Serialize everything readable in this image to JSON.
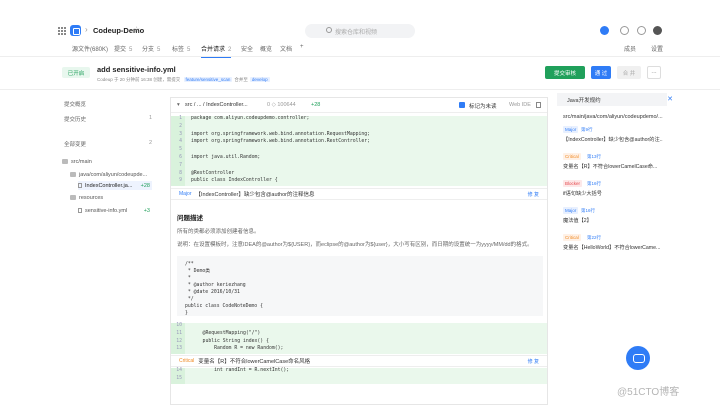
{
  "app": {
    "repo_name": "Codeup-Demo",
    "search_placeholder": "搜索仓库和视频"
  },
  "tabs": [
    {
      "label": "源文件(680K)",
      "count": ""
    },
    {
      "label": "提交",
      "count": "5"
    },
    {
      "label": "分支",
      "count": "5"
    },
    {
      "label": "标签",
      "count": "5"
    },
    {
      "label": "合并请求",
      "count": "2"
    },
    {
      "label": "安全",
      "count": ""
    },
    {
      "label": "概览",
      "count": ""
    },
    {
      "label": "文档",
      "count": ""
    },
    {
      "label": "+",
      "count": ""
    }
  ],
  "tabs_right": {
    "members": "成员",
    "settings": "设置"
  },
  "mr": {
    "status": "已开启",
    "title": "add sensitive-info.yml",
    "meta_prefix": "Codeup 于 20 分钟前 16:38 创建，需提交",
    "source_branch": "feature/sensitive_scan",
    "meta_mid": "合并至",
    "target_branch": "develop",
    "review_btn": "提交审核",
    "pass_btn": "通 过",
    "merge_btn": "合 并",
    "more_btn": "···"
  },
  "left": {
    "overview": "提交概览",
    "history": "提交历史",
    "history_count": "1",
    "changes": "全部变更",
    "changes_count": "2",
    "tree": [
      {
        "label": "src/main",
        "type": "folder"
      },
      {
        "label": "java/com/aliyun/codeupde...",
        "type": "folder"
      },
      {
        "label": "IndexController.ja...",
        "type": "file",
        "add": "+28"
      },
      {
        "label": "resources",
        "type": "folder"
      },
      {
        "label": "sensitive-info.yml",
        "type": "file",
        "add": "+3"
      }
    ]
  },
  "file": {
    "path": "src / ... / IndexController...",
    "stats": "0 ◇ 100644",
    "added": "+28",
    "mark_read": "标记为未读",
    "web_ide": "Web IDE"
  },
  "code_lines": [
    {
      "n": "1",
      "t": "package com.aliyun.codeupdemo.controller;"
    },
    {
      "n": "2",
      "t": ""
    },
    {
      "n": "3",
      "t": "import org.springframework.web.bind.annotation.RequestMapping;"
    },
    {
      "n": "4",
      "t": "import org.springframework.web.bind.annotation.RestController;"
    },
    {
      "n": "5",
      "t": ""
    },
    {
      "n": "6",
      "t": "import java.util.Random;"
    },
    {
      "n": "7",
      "t": ""
    },
    {
      "n": "8",
      "t": "@RestController"
    },
    {
      "n": "9",
      "t": "public class IndexController {"
    }
  ],
  "comment1": {
    "severity": "Major",
    "text": "【IndexController】缺少包含@author的注释信息",
    "fix": "修 复"
  },
  "issue": {
    "title": "问题描述",
    "p1": "所有的类都必须添加创建者信息。",
    "p2": "说明：在设置模板时，注意IDEA的@author为${USER}，而eclipse的@author为${user}，大小写有区别，而日期的设置统一为yyyy/MM/dd的格式。",
    "code": "/**\n * Demo类\n *\n * @author keriezhang\n * @date 2016/10/31\n */\npublic class CodeNoteDemo {\n}"
  },
  "code_lines2": [
    {
      "n": "10",
      "t": ""
    },
    {
      "n": "11",
      "t": "    @RequestMapping(\"/\")"
    },
    {
      "n": "12",
      "t": "    public String index() {"
    },
    {
      "n": "13",
      "t": "        Random R = new Random();"
    }
  ],
  "comment2": {
    "severity": "Critical",
    "text": "变量名【R】不符合lowerCamelCase命名风格",
    "fix": "修 复"
  },
  "code_lines3": [
    {
      "n": "14",
      "t": "        int randInt = R.nextInt();"
    },
    {
      "n": "15",
      "t": ""
    }
  ],
  "right": {
    "title": "Java开发规约",
    "path": "src/main/java/com/aliyun/codeupdemo/...",
    "items": [
      {
        "severity": "Major",
        "line": "第9行",
        "msg": "【IndexController】缺少包含@author的注..."
      },
      {
        "severity": "Critical",
        "line": "第13行",
        "msg": "变量名【R】不符合lowerCamelCase命..."
      },
      {
        "severity": "Blocker",
        "line": "第16行",
        "msg": "if语句缺少大括号"
      },
      {
        "severity": "Major",
        "line": "第16行",
        "msg": "魔法值【2】"
      },
      {
        "severity": "Critical",
        "line": "第22行",
        "msg": "变量名【HelloWorld】不符合lowerCame..."
      }
    ]
  },
  "watermark": "@51CTO博客",
  "colors": {
    "accent": "#2f7cf6",
    "success": "#20a05b",
    "critical": "#f08a24",
    "blocker": "#e5484d"
  }
}
